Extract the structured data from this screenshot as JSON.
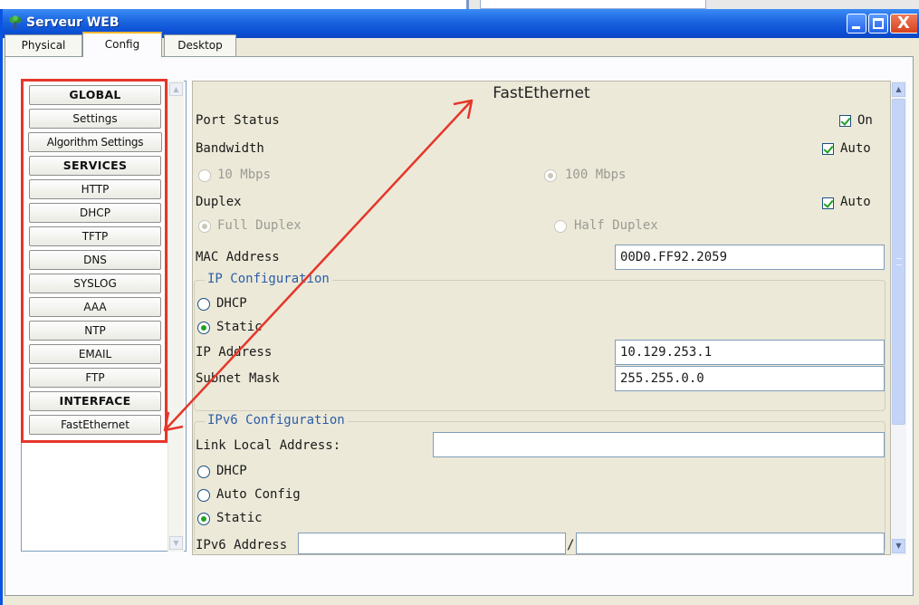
{
  "window": {
    "title": "Serveur WEB",
    "icons": {
      "app": "server-tree-icon",
      "minimize": "minimize-icon",
      "maximize": "maximize-icon",
      "close": "close-icon"
    },
    "close_glyph": "X"
  },
  "tabs": [
    "Physical",
    "Config",
    "Desktop"
  ],
  "sidebar": {
    "items": [
      "GLOBAL",
      "Settings",
      "Algorithm Settings",
      "SERVICES",
      "HTTP",
      "DHCP",
      "TFTP",
      "DNS",
      "SYSLOG",
      "AAA",
      "NTP",
      "EMAIL",
      "FTP",
      "INTERFACE",
      "FastEthernet"
    ]
  },
  "panel": {
    "title": "FastEthernet",
    "port_status_label": "Port Status",
    "port_on_label": "On",
    "bandwidth_label": "Bandwidth",
    "bandwidth_auto_label": "Auto",
    "bw_10": "10 Mbps",
    "bw_100": "100 Mbps",
    "duplex_label": "Duplex",
    "duplex_auto_label": "Auto",
    "full_duplex": "Full Duplex",
    "half_duplex": "Half Duplex",
    "mac_label": "MAC Address",
    "mac_value": "00D0.FF92.2059",
    "ip_config": {
      "legend": "IP Configuration",
      "dhcp": "DHCP",
      "static": "Static",
      "ip_label": "IP Address",
      "ip_value": "10.129.253.1",
      "mask_label": "Subnet Mask",
      "mask_value": "255.255.0.0"
    },
    "ipv6_config": {
      "legend": "IPv6 Configuration",
      "link_local_label": "Link Local Address:",
      "link_local_value": "",
      "dhcp": "DHCP",
      "auto": "Auto Config",
      "static": "Static",
      "address_label": "IPv6 Address",
      "address_value": "",
      "prefix_sep": "/",
      "prefix_value": ""
    }
  },
  "state": {
    "active_tab": "Config",
    "port_on": true,
    "bandwidth_auto": true,
    "bandwidth_selected": "100 Mbps",
    "duplex_auto": true,
    "duplex_selected": "Full Duplex",
    "ip_mode": "Static",
    "ipv6_mode": "Static"
  },
  "colors": {
    "annotation": "#e5362a",
    "titlebar": "#0a54e3",
    "panel_bg": "#ece9d8",
    "section_legend": "#2b5ca8",
    "check_green": "#21a121"
  }
}
